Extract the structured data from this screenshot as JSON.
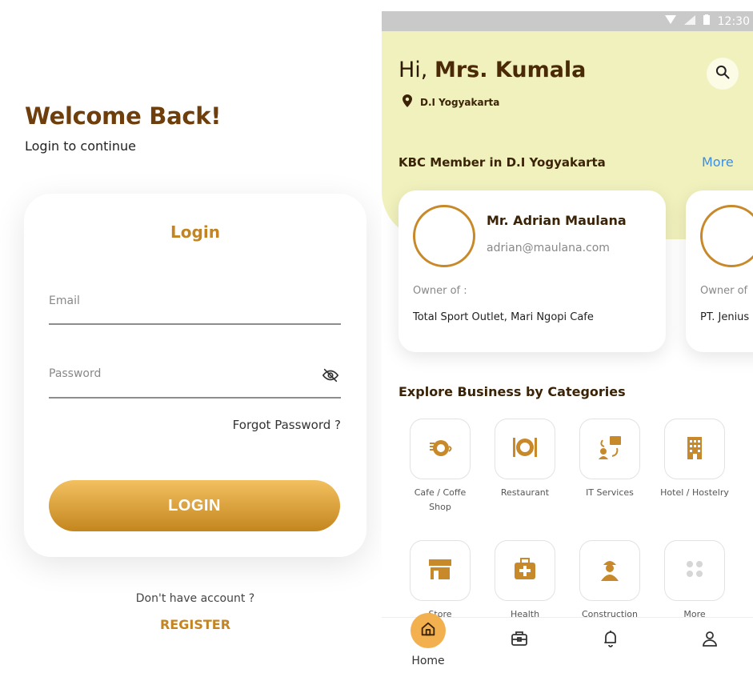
{
  "login": {
    "title": "Welcome Back!",
    "subtitle": "Login to continue",
    "card_title": "Login",
    "email_placeholder": "Email",
    "password_placeholder": "Password",
    "forgot": "Forgot Password ?",
    "login_button": "LOGIN",
    "no_account": "Don't have account ?",
    "register": "REGISTER"
  },
  "home": {
    "status_time": "12:30",
    "greeting_prefix": "Hi, ",
    "greeting_name": "Mrs. Kumala",
    "location": "D.I Yogyakarta",
    "kbc_title": "KBC Member in D.I Yogyakarta",
    "kbc_more": "More",
    "members": [
      {
        "name": "Mr. Adrian Maulana",
        "email": "adrian@maulana.com",
        "owner_label": "Owner of :",
        "owner_value": "Total Sport Outlet, Mari Ngopi Cafe"
      },
      {
        "name": "",
        "email": "",
        "owner_label": "Owner of",
        "owner_value": "PT. Jenius"
      }
    ],
    "categories_title": "Explore Business by Categories",
    "categories": [
      {
        "label": "Cafe / Coffe Shop",
        "icon": "coffee-icon"
      },
      {
        "label": "Restaurant",
        "icon": "plate-icon"
      },
      {
        "label": "IT Services",
        "icon": "it-icon"
      },
      {
        "label": "Hotel / Hostelry",
        "icon": "hotel-icon"
      },
      {
        "label": "Store",
        "icon": "store-icon"
      },
      {
        "label": "Health",
        "icon": "medkit-icon"
      },
      {
        "label": "Construction",
        "icon": "worker-icon"
      },
      {
        "label": "More",
        "icon": "grid-icon"
      }
    ],
    "nav": {
      "home_label": "Home"
    },
    "colors": {
      "accent": "#c48421",
      "header_bg": "#f1f1bd",
      "link_blue": "#3a8ee6"
    }
  }
}
